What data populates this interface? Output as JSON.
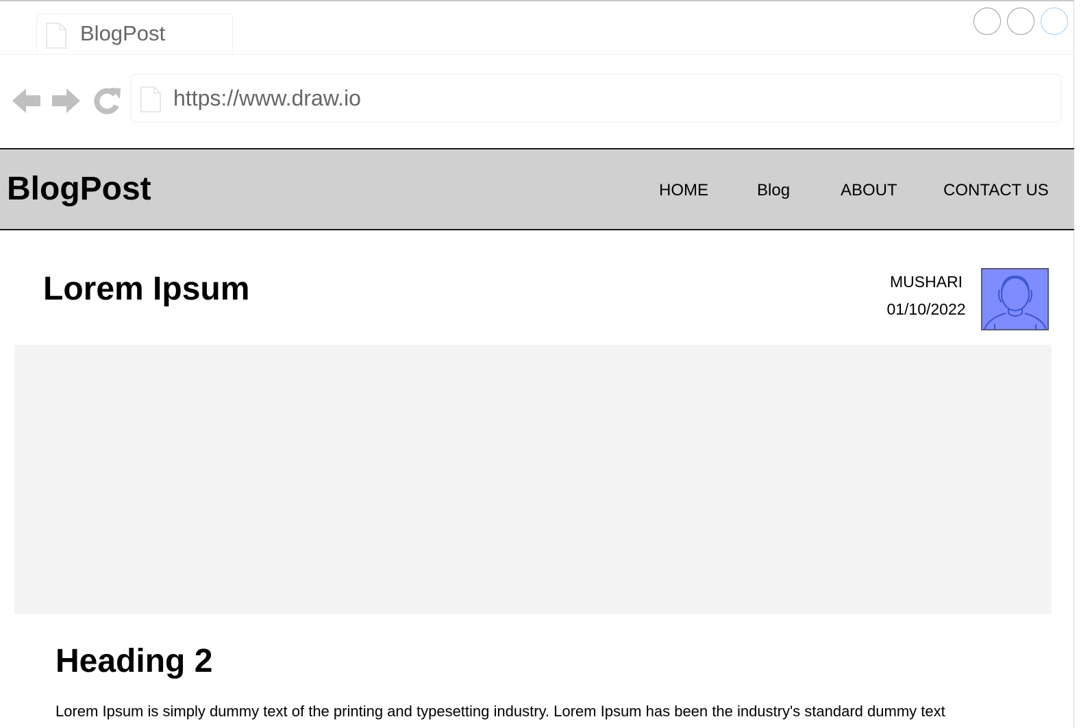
{
  "browser": {
    "tab_title": "BlogPost",
    "url": "https://www.draw.io"
  },
  "navbar": {
    "brand": "BlogPost",
    "links": [
      "HOME",
      "Blog",
      "ABOUT",
      "CONTACT US"
    ]
  },
  "post": {
    "title": "Lorem Ipsum",
    "author": "MUSHARI",
    "date": "01/10/2022",
    "heading2": "Heading 2",
    "paragraph": "Lorem Ipsum is simply dummy text of the printing and typesetting industry. Lorem Ipsum has been the industry's standard dummy text"
  },
  "colors": {
    "navbar_bg": "#d0d0d0",
    "avatar_bg": "#7f8cff",
    "hero_bg": "#f4f4f4",
    "chrome_text": "#666666",
    "chrome_icon": "#c0c0c0"
  },
  "icons": {
    "tab": "document-icon",
    "address": "document-icon",
    "back": "arrow-left-icon",
    "forward": "arrow-right-icon",
    "reload": "reload-icon",
    "avatar": "user-avatar-icon"
  }
}
